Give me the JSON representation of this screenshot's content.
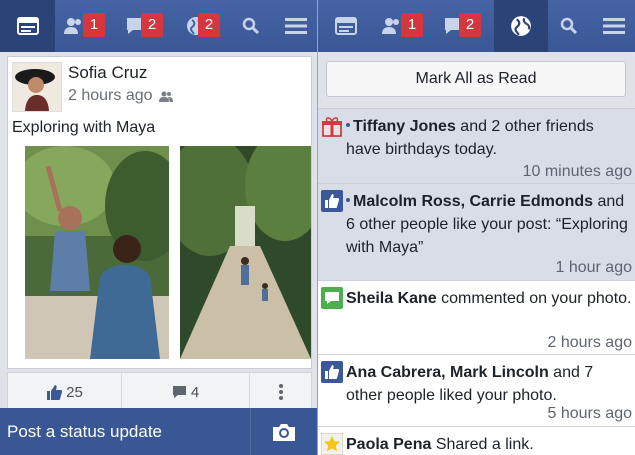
{
  "left_nav": {
    "items": [
      {
        "icon": "news-feed-icon",
        "badge": null
      },
      {
        "icon": "friend-requests-icon",
        "badge": "1"
      },
      {
        "icon": "messages-icon",
        "badge": "2"
      },
      {
        "icon": "notifications-globe-icon",
        "badge": "2"
      },
      {
        "icon": "search-icon",
        "badge": null
      },
      {
        "icon": "menu-icon",
        "badge": null
      }
    ]
  },
  "right_nav": {
    "items": [
      {
        "icon": "news-feed-icon",
        "badge": null
      },
      {
        "icon": "friend-requests-icon",
        "badge": "1"
      },
      {
        "icon": "messages-icon",
        "badge": "2"
      },
      {
        "icon": "notifications-globe-icon",
        "badge": null,
        "active": true
      },
      {
        "icon": "search-icon",
        "badge": null
      },
      {
        "icon": "menu-icon",
        "badge": null
      }
    ]
  },
  "post": {
    "author": "Sofia Cruz",
    "time": "2 hours ago",
    "privacy_icon": "friends-icon",
    "text": "Exploring with Maya",
    "likes": "25",
    "comments": "4"
  },
  "status_bar": {
    "placeholder": "Post a status update",
    "camera_icon": "camera-icon"
  },
  "notifications": {
    "mark_all_label": "Mark All as Read",
    "items": [
      {
        "icon": "gift-icon",
        "name": "Tiffany Jones",
        "rest": " and 2 other friends have birthdays today.",
        "time": "10 minutes ago",
        "unread": true
      },
      {
        "icon": "like-icon",
        "name": "Malcolm Ross, Carrie Edmonds",
        "rest": " and 6 other people like your post: “Exploring with Maya”",
        "time": "1 hour ago",
        "unread": true
      },
      {
        "icon": "comment-icon",
        "name": "Sheila Kane",
        "rest": " commented on your photo.",
        "time": "2 hours ago",
        "unread": false
      },
      {
        "icon": "like-icon",
        "name": "Ana Cabrera, Mark Lincoln",
        "rest": " and 7 other people liked your photo.",
        "time": "5 hours ago",
        "unread": false
      },
      {
        "icon": "star-icon",
        "name": "Paola Pena",
        "rest": " Shared a link.",
        "time": "",
        "unread": false
      }
    ]
  },
  "colors": {
    "brand": "#3b5998",
    "badge": "#d8363f",
    "unread_bg": "#d8dde7"
  }
}
